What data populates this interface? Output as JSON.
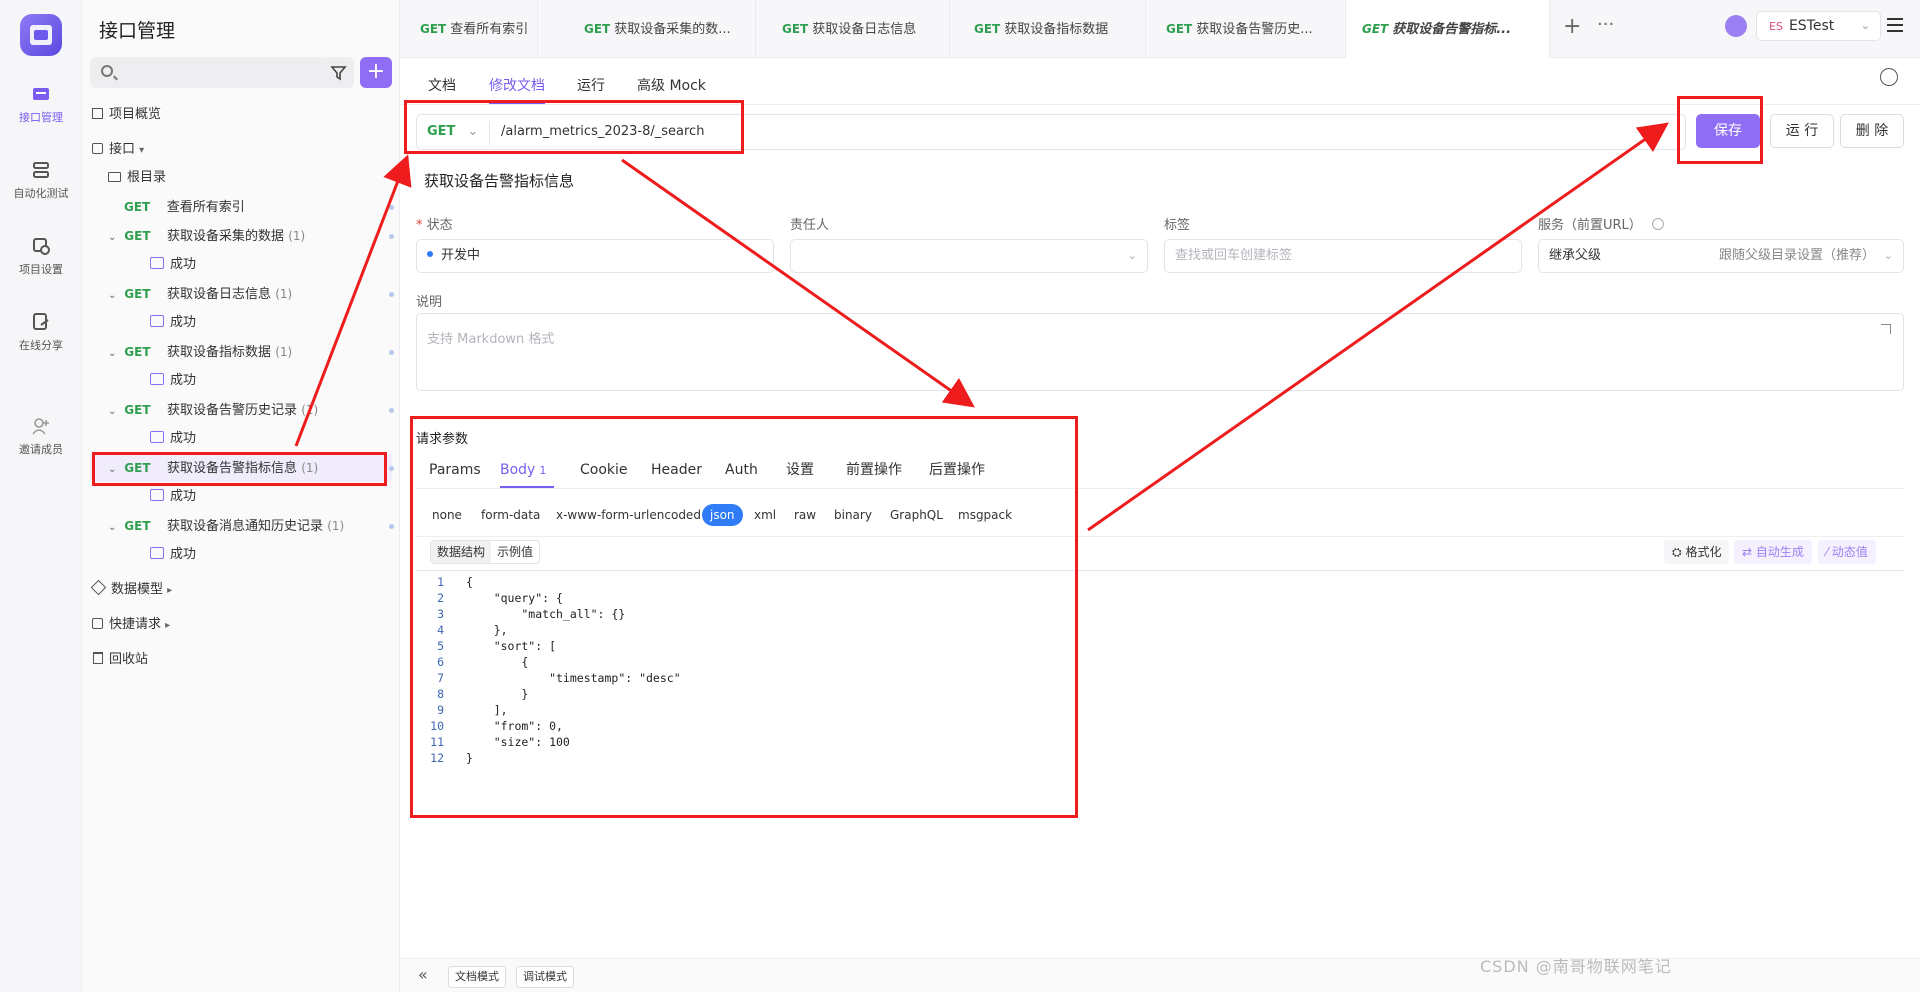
{
  "rail": [
    {
      "label": "接口管理",
      "icon": "api-icon",
      "active": true
    },
    {
      "label": "自动化测试",
      "icon": "automation-icon"
    },
    {
      "label": "项目设置",
      "icon": "settings-icon"
    },
    {
      "label": "在线分享",
      "icon": "share-icon"
    },
    {
      "label": "邀请成员",
      "icon": "invite-member-icon"
    }
  ],
  "sidebar": {
    "title": "接口管理",
    "overview": "项目概览",
    "api_group": "接口",
    "root": "根目录",
    "items": [
      {
        "method": "GET",
        "name": "查看所有索引",
        "count": ""
      },
      {
        "method": "GET",
        "name": "获取设备采集的数据",
        "count": "(1)"
      },
      {
        "method": "",
        "name": "成功",
        "count": ""
      },
      {
        "method": "GET",
        "name": "获取设备日志信息",
        "count": "(1)"
      },
      {
        "method": "",
        "name": "成功",
        "count": ""
      },
      {
        "method": "GET",
        "name": "获取设备指标数据",
        "count": "(1)"
      },
      {
        "method": "",
        "name": "成功",
        "count": ""
      },
      {
        "method": "GET",
        "name": "获取设备告警历史记录",
        "count": "(1)"
      },
      {
        "method": "",
        "name": "成功",
        "count": ""
      },
      {
        "method": "GET",
        "name": "获取设备告警指标信息",
        "count": "(1)"
      },
      {
        "method": "",
        "name": "成功",
        "count": ""
      },
      {
        "method": "GET",
        "name": "获取设备消息通知历史记录",
        "count": "(1)"
      },
      {
        "method": "",
        "name": "成功",
        "count": ""
      }
    ],
    "data_model": "数据模型",
    "quick_request": "快捷请求",
    "recycle_bin": "回收站"
  },
  "tabs": [
    {
      "method": "GET",
      "label": "查看所有索引"
    },
    {
      "method": "GET",
      "label": "获取设备采集的数..."
    },
    {
      "method": "GET",
      "label": "获取设备日志信息"
    },
    {
      "method": "GET",
      "label": "获取设备指标数据"
    },
    {
      "method": "GET",
      "label": "获取设备告警历史..."
    },
    {
      "method": "GET",
      "label": "获取设备告警指标..."
    }
  ],
  "project": {
    "badge": "ES",
    "name": "ESTest"
  },
  "subtabs": [
    "文档",
    "修改文档",
    "运行",
    "高级 Mock"
  ],
  "request": {
    "method": "GET",
    "url": "/alarm_metrics_2023-8/_search",
    "save": "保存",
    "run": "运 行",
    "delete": "删 除"
  },
  "api_name": "获取设备告警指标信息",
  "fields": {
    "status_label": "状态",
    "status_value": "开发中",
    "owner_label": "责任人",
    "tags_label": "标签",
    "tags_placeholder": "查找或回车创建标签",
    "service_label": "服务（前置URL）",
    "service_value": "继承父级",
    "service_hint": "跟随父级目录设置（推荐）",
    "desc_label": "说明",
    "desc_placeholder": "支持 Markdown 格式"
  },
  "params": {
    "title": "请求参数",
    "tabs": [
      "Params",
      "Body",
      "Cookie",
      "Header",
      "Auth",
      "设置",
      "前置操作",
      "后置操作"
    ],
    "body_badge": "1",
    "body_types": [
      "none",
      "form-data",
      "x-www-form-urlencoded",
      "json",
      "xml",
      "raw",
      "binary",
      "GraphQL",
      "msgpack"
    ],
    "seg": [
      "数据结构",
      "示例值"
    ],
    "tools": [
      "格式化",
      "自动生成",
      "动态值"
    ]
  },
  "code_lines": [
    "{",
    "    \"query\": {",
    "        \"match_all\": {}",
    "    },",
    "    \"sort\": [",
    "        {",
    "            \"timestamp\": \"desc\"",
    "        }",
    "    ],",
    "    \"from\": 0,",
    "    \"size\": 100",
    "}"
  ],
  "footer": {
    "collapse": "«",
    "doc_mode": "文档模式",
    "debug_mode": "调试模式"
  },
  "watermark": "CSDN @南哥物联网笔记",
  "colors": {
    "accent": "#8f6ef5",
    "get": "#2e9f4e",
    "annotation": "#ee1c1c",
    "json_active": "#2f7cf6"
  }
}
